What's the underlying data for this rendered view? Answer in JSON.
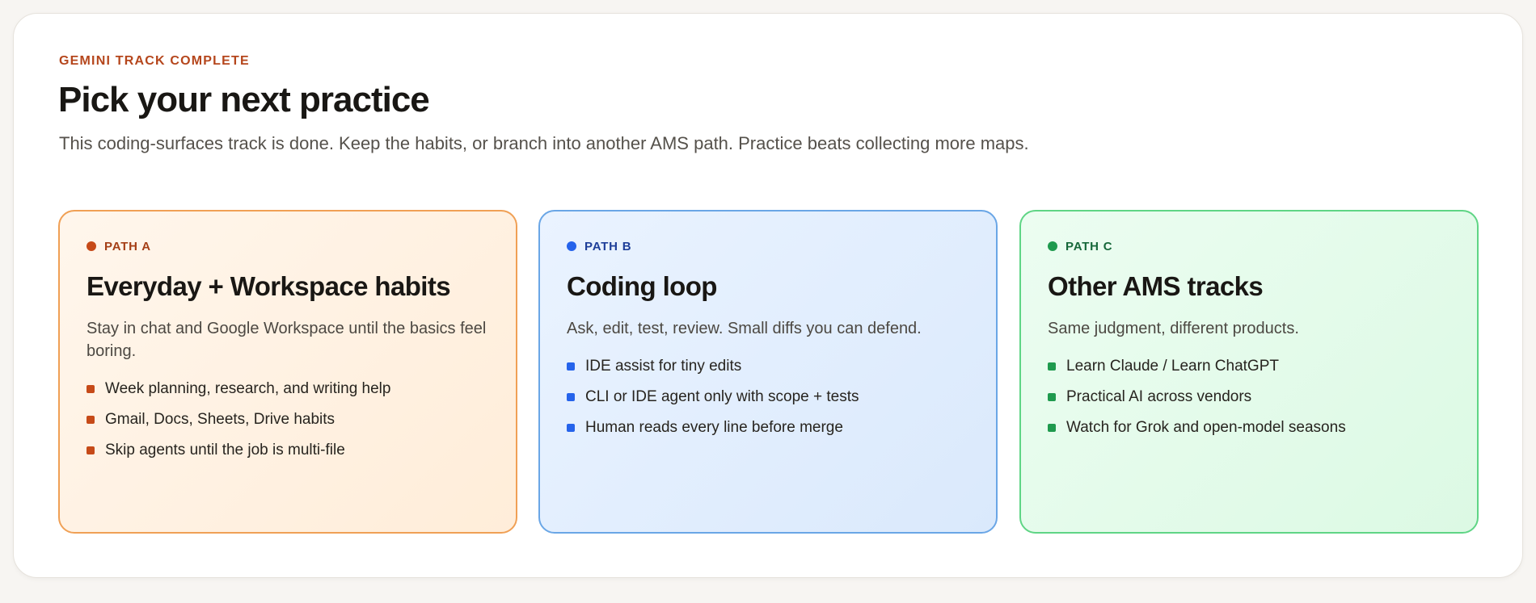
{
  "header": {
    "eyebrow": "GEMINI TRACK COMPLETE",
    "title": "Pick your next practice",
    "intro": "This coding-surfaces track is done. Keep the habits, or branch into another AMS path. Practice beats collecting more maps."
  },
  "paths": [
    {
      "tag": "PATH A",
      "title": "Everyday + Workspace habits",
      "description": "Stay in chat and Google Workspace until the basics feel boring.",
      "items": [
        "Week planning, research, and writing help",
        "Gmail, Docs, Sheets, Drive habits",
        "Skip agents until the job is multi-file"
      ],
      "accent": "#c64a18"
    },
    {
      "tag": "PATH B",
      "title": "Coding loop",
      "description": "Ask, edit, test, review. Small diffs you can defend.",
      "items": [
        "IDE assist for tiny edits",
        "CLI or IDE agent only with scope + tests",
        "Human reads every line before merge"
      ],
      "accent": "#2563eb"
    },
    {
      "tag": "PATH C",
      "title": "Other AMS tracks",
      "description": "Same judgment, different products.",
      "items": [
        "Learn Claude / Learn ChatGPT",
        "Practical AI across vendors",
        "Watch for Grok and open-model seasons"
      ],
      "accent": "#1f9a4e"
    }
  ]
}
